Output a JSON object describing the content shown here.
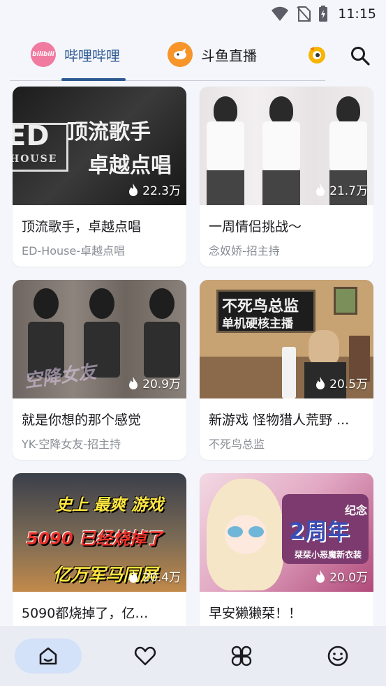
{
  "status_bar": {
    "time": "11:15"
  },
  "tabs": [
    {
      "label": "哔哩哔哩",
      "active": true,
      "logo_text": "bilibili"
    },
    {
      "label": "斗鱼直播",
      "active": false
    }
  ],
  "cards": [
    {
      "title": "顶流歌手，卓越点唱",
      "subtitle": "ED-House-卓越点唱",
      "heat": "22.3万",
      "thumb_text": [
        "顶流歌手",
        "卓越点唱"
      ],
      "thumb_logo": "ED",
      "thumb_logo_sub": "HOUSE"
    },
    {
      "title": "一周情侣挑战～",
      "subtitle": "念奴娇-招主持",
      "heat": "21.7万"
    },
    {
      "title": "就是你想的那个感觉",
      "subtitle": "YK-空降女友-招主持",
      "heat": "20.9万",
      "thumb_text": [
        "空降女友"
      ]
    },
    {
      "title": "新游戏 怪物猎人荒野 ...",
      "subtitle": "不死鸟总监",
      "heat": "20.5万",
      "thumb_text": [
        "不死鸟总监",
        "单机硬核主播"
      ]
    },
    {
      "title": "5090都烧掉了，亿…",
      "subtitle": "",
      "heat": "20.4万",
      "thumb_text": [
        "史上 最爽 游戏",
        "5090 已经烧掉了",
        "亿万军马同屏"
      ]
    },
    {
      "title": "早安獭獭栞！！",
      "subtitle": "",
      "heat": "20.0万",
      "thumb_text": [
        "纪念",
        "2周年",
        "栞栞小恶魔新衣装"
      ]
    }
  ],
  "colors": {
    "accent": "#2e5a92",
    "nav_active": "#d3e2f8",
    "background": "#f4f6fb"
  }
}
